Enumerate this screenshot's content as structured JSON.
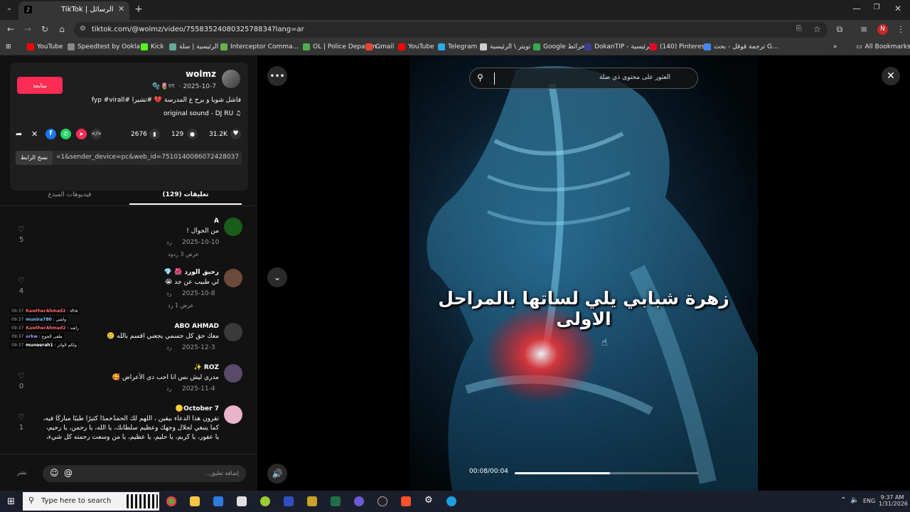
{
  "browser": {
    "tab_title": "TikTok | الرسائل",
    "url": "tiktok.com/@wolmz/video/7558352408032578834?lang=ar",
    "bookmarks": [
      {
        "label": "YouTube",
        "color": "#ff0000"
      },
      {
        "label": "Speedtest by Ookla...",
        "color": "#888888"
      },
      {
        "label": "Kick",
        "color": "#53fc18"
      },
      {
        "label": "الرئيسية | سلة",
        "color": "#5fa89a"
      },
      {
        "label": "Interceptor Comma...",
        "color": "#6ab04c"
      },
      {
        "label": "OL | Police Departm...",
        "color": "#4caf50"
      },
      {
        "label": "Gmail",
        "color": "#ea4335"
      },
      {
        "label": "YouTube",
        "color": "#ff0000"
      },
      {
        "label": "Telegram",
        "color": "#2aabee"
      },
      {
        "label": "تويتر \\ الرئيسية",
        "color": "#cccccc"
      },
      {
        "label": "Google خرائط",
        "color": "#34a853"
      },
      {
        "label": "DokanTIP - الرئيسية",
        "color": "#3b3b8f"
      },
      {
        "label": "(140) Pinterest",
        "color": "#e60023"
      },
      {
        "label": "ترجمة قوقل - بحث G...",
        "color": "#4285f4"
      }
    ],
    "all_bookmarks": "All Bookmarks",
    "profile_initial": "N"
  },
  "post": {
    "username": "wolmz",
    "display_line": "2025-10-7 · ⁦🌷୨ৎ ⁩🫧",
    "follow_label": "متابعة",
    "caption": "فاشل شويا و يرح ع المدرسة 💔 #تشيرا #fyp #virall",
    "sound": "original sound - DJ RU",
    "stats": {
      "likes": "31.2K",
      "comments": "129",
      "saves": "2676"
    },
    "link_text": "p=1&sender_device=pc&web_id=7510140086072428037...",
    "copy_link": "نسخ الرابط",
    "tabs": {
      "comments": "تعليقات (129)",
      "creator_videos": "فيديوهات المبدع"
    }
  },
  "comments": [
    {
      "author": "A",
      "text": "من الجوال !",
      "date": "2025-10-10",
      "reply": "رد",
      "likes": "5",
      "more": "عرض 3 ردود",
      "avatar": "#1a5c1a"
    },
    {
      "author": "رحيق الورد 🌺 💎",
      "text": "لي طبيب عن جد 😭",
      "date": "2025-10-8",
      "reply": "رد",
      "likes": "4",
      "more": "عرض 1 رد",
      "avatar": "#6b4a3a"
    },
    {
      "author": "ABO AHMAD",
      "text": "معك حق كل جسمي يجعني اقسم بالله 🥲",
      "date": "2025-12-3",
      "reply": "رد",
      "likes": "",
      "more": "",
      "avatar": "#3a3a3a"
    },
    {
      "author": "ROZ ✨",
      "text": "مدري ليش بس انا احب دي الأعراض 🥰",
      "date": "2025-11-4",
      "reply": "رد",
      "likes": "0",
      "more": "",
      "avatar": "#5a4a6a"
    },
    {
      "author": "October 7🟡",
      "text": "تقرون هذا الدعاء بيقين ، اللهم لك الحمدُحمدًا كثيرًا طيبًا مباركًا فيه، كما ينبغي لجلال وجهك وعظيم سلطانك، يا الله، يا رحمن، يا رحيم، يا عفور، يا كريم، يا حليم، يا عظيم، يا من وسعت رحمته كل شيء، يا من بيده الخير",
      "date": "",
      "reply": "",
      "likes": "1",
      "more": "",
      "avatar": "#e8b4c8"
    }
  ],
  "overlay_chat": [
    {
      "time": "09:37",
      "user": "KawtherAhmad2",
      "msg": "vha",
      "color": "#ff6b6b"
    },
    {
      "time": "09:37",
      "user": "munira780",
      "msg": "واشي",
      "color": "#7ec8ff"
    },
    {
      "time": "09:37",
      "user": "KawtherAhmad2",
      "msg": "راشد",
      "color": "#ff6b6b"
    },
    {
      "time": "09:37",
      "user": "orkw",
      "msg": "طفى الجوع",
      "color": "#b58cff"
    },
    {
      "time": "09:37",
      "user": "muneerah1",
      "msg": "ولكم الواثر",
      "color": "#ffffff"
    }
  ],
  "comment_input": {
    "placeholder": "إضافة تعليق...",
    "post_label": "نشر"
  },
  "video": {
    "search_placeholder": "العثور على محتوى ذي صلة",
    "caption_text": "زهرة شبابي يلي لساتها بالمراحل الاولى",
    "time": "00:08/00:04",
    "progress_fraction": 0.52
  },
  "taskbar": {
    "search_placeholder": "Type here to search",
    "lang": "ENG",
    "time": "9:37 AM",
    "date": "1/31/2026"
  }
}
